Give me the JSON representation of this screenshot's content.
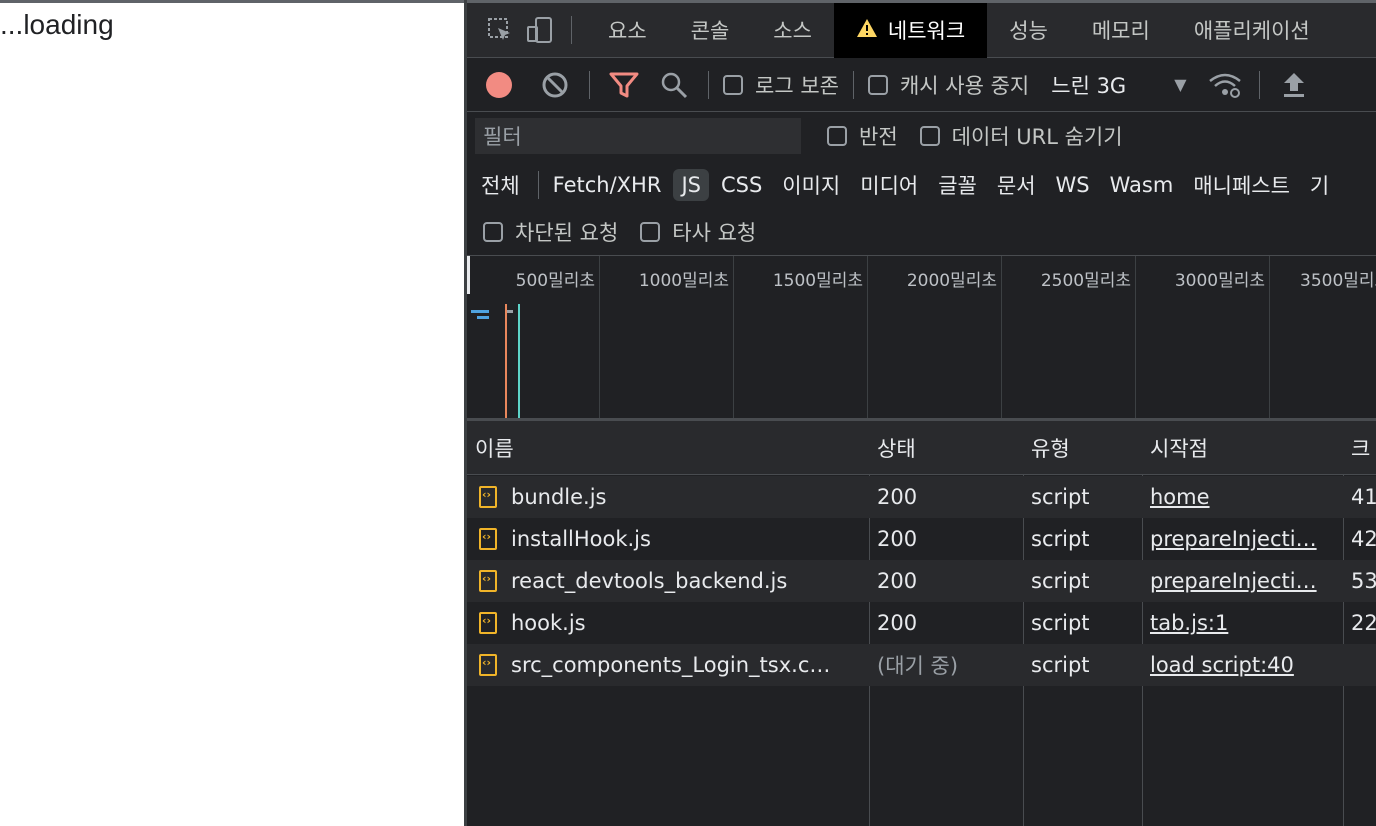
{
  "page": {
    "loading_text": "...loading"
  },
  "devtools": {
    "tabs": [
      "요소",
      "콘솔",
      "소스",
      "네트워크",
      "성능",
      "메모리",
      "애플리케이션"
    ],
    "active_tab": "네트워크",
    "toolbar": {
      "preserve_log": "로그 보존",
      "disable_cache": "캐시 사용 중지",
      "throttling": "느린 3G"
    },
    "filter": {
      "placeholder": "필터",
      "invert": "반전",
      "hide_data_urls": "데이터 URL 숨기기"
    },
    "types": [
      "전체",
      "Fetch/XHR",
      "JS",
      "CSS",
      "이미지",
      "미디어",
      "글꼴",
      "문서",
      "WS",
      "Wasm",
      "매니페스트",
      "기"
    ],
    "selected_type": "JS",
    "blocked_requests": "차단된 요청",
    "third_party": "타사 요청",
    "timeline_ticks": [
      "500밀리초",
      "1000밀리초",
      "1500밀리초",
      "2000밀리초",
      "2500밀리초",
      "3000밀리초",
      "3500밀리초"
    ],
    "columns": {
      "name": "이름",
      "status": "상태",
      "type": "유형",
      "initiator": "시작점",
      "size": "크"
    },
    "rows": [
      {
        "name": "bundle.js",
        "status": "200",
        "type": "script",
        "initiator": "home",
        "size": "41"
      },
      {
        "name": "installHook.js",
        "status": "200",
        "type": "script",
        "initiator": "prepareInjecti…",
        "size": "42"
      },
      {
        "name": "react_devtools_backend.js",
        "status": "200",
        "type": "script",
        "initiator": "prepareInjecti…",
        "size": "53"
      },
      {
        "name": "hook.js",
        "status": "200",
        "type": "script",
        "initiator": "tab.js:1",
        "size": "22"
      },
      {
        "name": "src_components_Login_tsx.c…",
        "status": "(대기 중)",
        "type": "script",
        "initiator": "load script:40",
        "size": ""
      }
    ],
    "colors": {
      "record": "#f28b82",
      "filter_active": "#f28b82",
      "js_icon": "#f0b429"
    }
  }
}
